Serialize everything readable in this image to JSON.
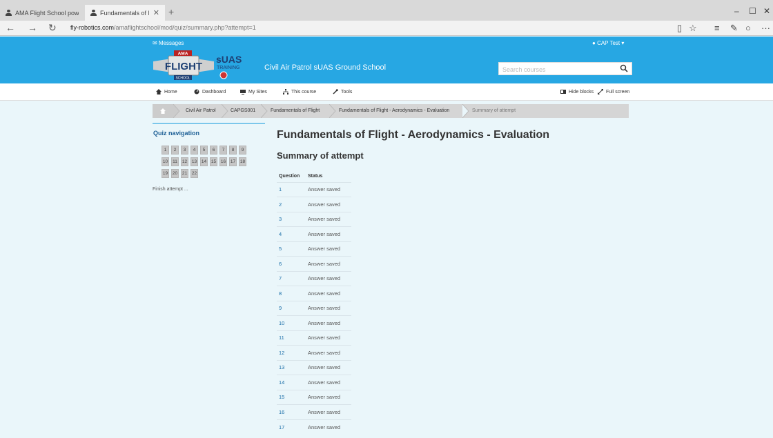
{
  "browser": {
    "tabs": [
      {
        "label": "AMA Flight School powerec"
      },
      {
        "label": "Fundamentals of Flight"
      }
    ],
    "url_host": "fly-robotics.com",
    "url_path": "/amaflightschool/mod/quiz/summary.php?attempt=1",
    "window_controls": [
      "–",
      "☐",
      "✕"
    ]
  },
  "header": {
    "messages": "Messages",
    "user": "CAP Test",
    "logo_ama": "AMA",
    "logo_flight": "FLIGHT",
    "logo_school": "SCHOOL",
    "logo_suas": "sUAS",
    "logo_training": "TRAINING",
    "school_name": "Civil Air Patrol sUAS Ground School",
    "search_placeholder": "Search courses"
  },
  "nav": {
    "home": "Home",
    "dashboard": "Dashboard",
    "my_sites": "My Sites",
    "this_course": "This course",
    "tools": "Tools",
    "hide_blocks": "Hide blocks",
    "full_screen": "Full screen"
  },
  "breadcrumb": [
    "Civil Air Patrol",
    "CAPGS001",
    "Fundamentals of Flight",
    "Fundamentals of Flight - Aerodynamics - Evaluation",
    "Summary of attempt"
  ],
  "quiz_nav": {
    "title": "Quiz navigation",
    "questions": [
      "1",
      "2",
      "3",
      "4",
      "5",
      "6",
      "7",
      "8",
      "9",
      "10",
      "11",
      "12",
      "13",
      "14",
      "15",
      "16",
      "17",
      "18",
      "19",
      "20",
      "21",
      "22"
    ],
    "finish": "Finish attempt ..."
  },
  "main": {
    "title": "Fundamentals of Flight - Aerodynamics - Evaluation",
    "subtitle": "Summary of attempt",
    "col_question": "Question",
    "col_status": "Status",
    "rows": [
      {
        "q": "1",
        "status": "Answer saved"
      },
      {
        "q": "2",
        "status": "Answer saved"
      },
      {
        "q": "3",
        "status": "Answer saved"
      },
      {
        "q": "4",
        "status": "Answer saved"
      },
      {
        "q": "5",
        "status": "Answer saved"
      },
      {
        "q": "6",
        "status": "Answer saved"
      },
      {
        "q": "7",
        "status": "Answer saved"
      },
      {
        "q": "8",
        "status": "Answer saved"
      },
      {
        "q": "9",
        "status": "Answer saved"
      },
      {
        "q": "10",
        "status": "Answer saved"
      },
      {
        "q": "11",
        "status": "Answer saved"
      },
      {
        "q": "12",
        "status": "Answer saved"
      },
      {
        "q": "13",
        "status": "Answer saved"
      },
      {
        "q": "14",
        "status": "Answer saved"
      },
      {
        "q": "15",
        "status": "Answer saved"
      },
      {
        "q": "16",
        "status": "Answer saved"
      },
      {
        "q": "17",
        "status": "Answer saved"
      }
    ]
  },
  "colors": {
    "brand_blue": "#27a7e3",
    "page_bg": "#eaf6fa",
    "link_blue": "#1a6ea8"
  }
}
